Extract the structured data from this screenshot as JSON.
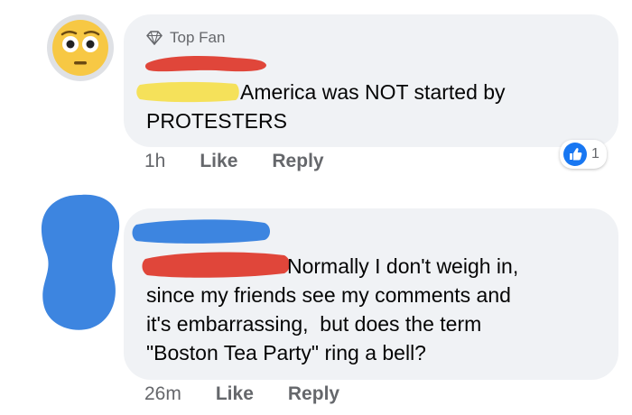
{
  "comments": [
    {
      "badge_icon": "diamond-icon",
      "badge_label": "Top Fan",
      "text": "America was NOT started by\nPROTESTERS",
      "time": "1h",
      "like_label": "Like",
      "reply_label": "Reply",
      "reaction": {
        "icon": "thumbs-up-icon",
        "count": "1"
      }
    },
    {
      "text": "Normally I don't weigh in,\nsince my friends see my comments and\nit's embarrassing,  but does the term\n\"Boston Tea Party\" ring a bell?",
      "time": "26m",
      "like_label": "Like",
      "reply_label": "Reply"
    }
  ],
  "colors": {
    "bubble": "#f0f2f5",
    "redact_red": "#e0463a",
    "redact_yellow": "#f5e15a",
    "redact_blue": "#3d85e0",
    "like_blue": "#1877f2",
    "meta_gray": "#65676b"
  }
}
